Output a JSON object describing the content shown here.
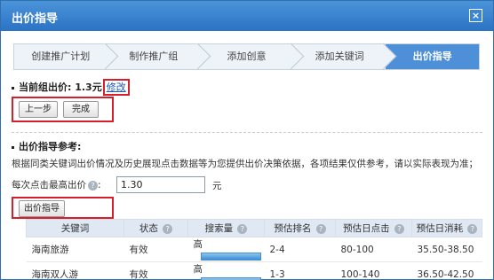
{
  "dialog": {
    "title": "出价指导",
    "close_glyph": "×"
  },
  "steps": [
    "创建推广计划",
    "制作推广组",
    "添加创意",
    "添加关键词",
    "出价指导"
  ],
  "active_step": 4,
  "current_bid": {
    "label": "当前组出价: 1.3元",
    "edit_label": "修改"
  },
  "buttons": {
    "prev": "上一步",
    "done": "完成",
    "guide": "出价指导"
  },
  "guide": {
    "section_title": "出价指导参考:",
    "description": "根据同类关键词出价情况及历史展现点击数据等为您提供出价决策依据，各项结果仅供参考，请以实际表现为准；",
    "max_bid_label": "每次点击最高出价",
    "max_bid_value": "1.30",
    "unit": "元"
  },
  "table": {
    "headers": [
      "关键词",
      "状态",
      "搜索量",
      "预估排名",
      "预估日点击",
      "预估日消耗"
    ],
    "rows": [
      [
        "海南旅游",
        "有效",
        "高",
        "2-4",
        "80-100",
        "35.50-38.50"
      ],
      [
        "海南双人游",
        "有效",
        "高",
        "1-3",
        "100-140",
        "36.50-42.50"
      ]
    ]
  }
}
